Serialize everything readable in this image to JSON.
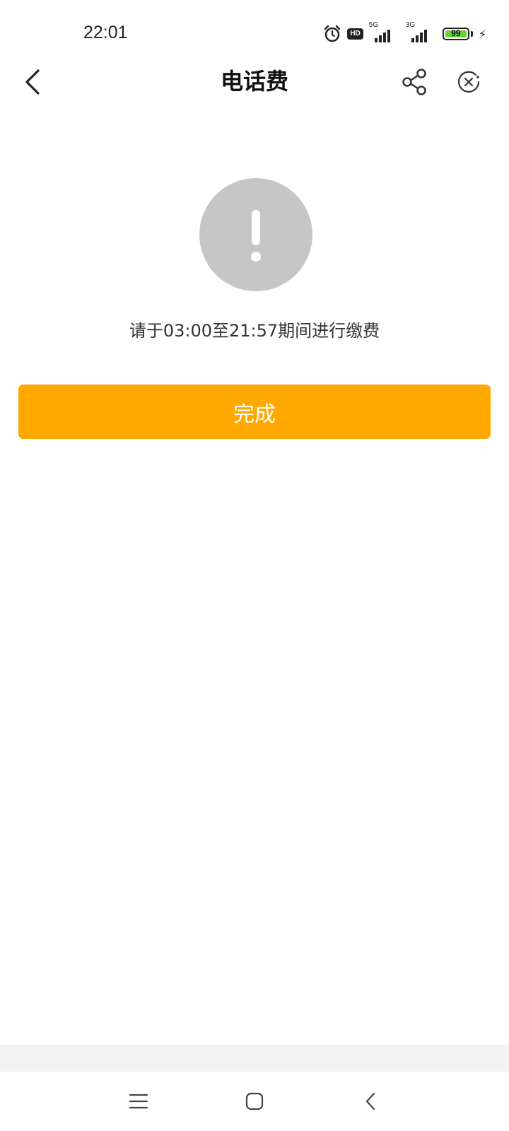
{
  "status_bar": {
    "time": "22:01",
    "network_1": "5G",
    "network_2": "3G",
    "hd_label": "HD",
    "battery": "99",
    "icons": [
      "alarm-icon",
      "hd-icon",
      "signal-icon",
      "signal-icon",
      "battery-icon",
      "charging-bolt-icon"
    ]
  },
  "header": {
    "title": "电话费",
    "back_icon": "chevron-left-icon",
    "share_icon": "share-icon",
    "close_icon": "close-circle-icon"
  },
  "content": {
    "status_icon": "exclamation-icon",
    "message": "请于03:00至21:57期间进行缴费",
    "done_label": "完成"
  },
  "nav_bar": {
    "icons": [
      "menu-icon",
      "home-icon",
      "back-icon"
    ]
  },
  "colors": {
    "accent": "#fea800",
    "icon_gray": "#c6c6c6",
    "battery_green": "#6ad13c"
  }
}
